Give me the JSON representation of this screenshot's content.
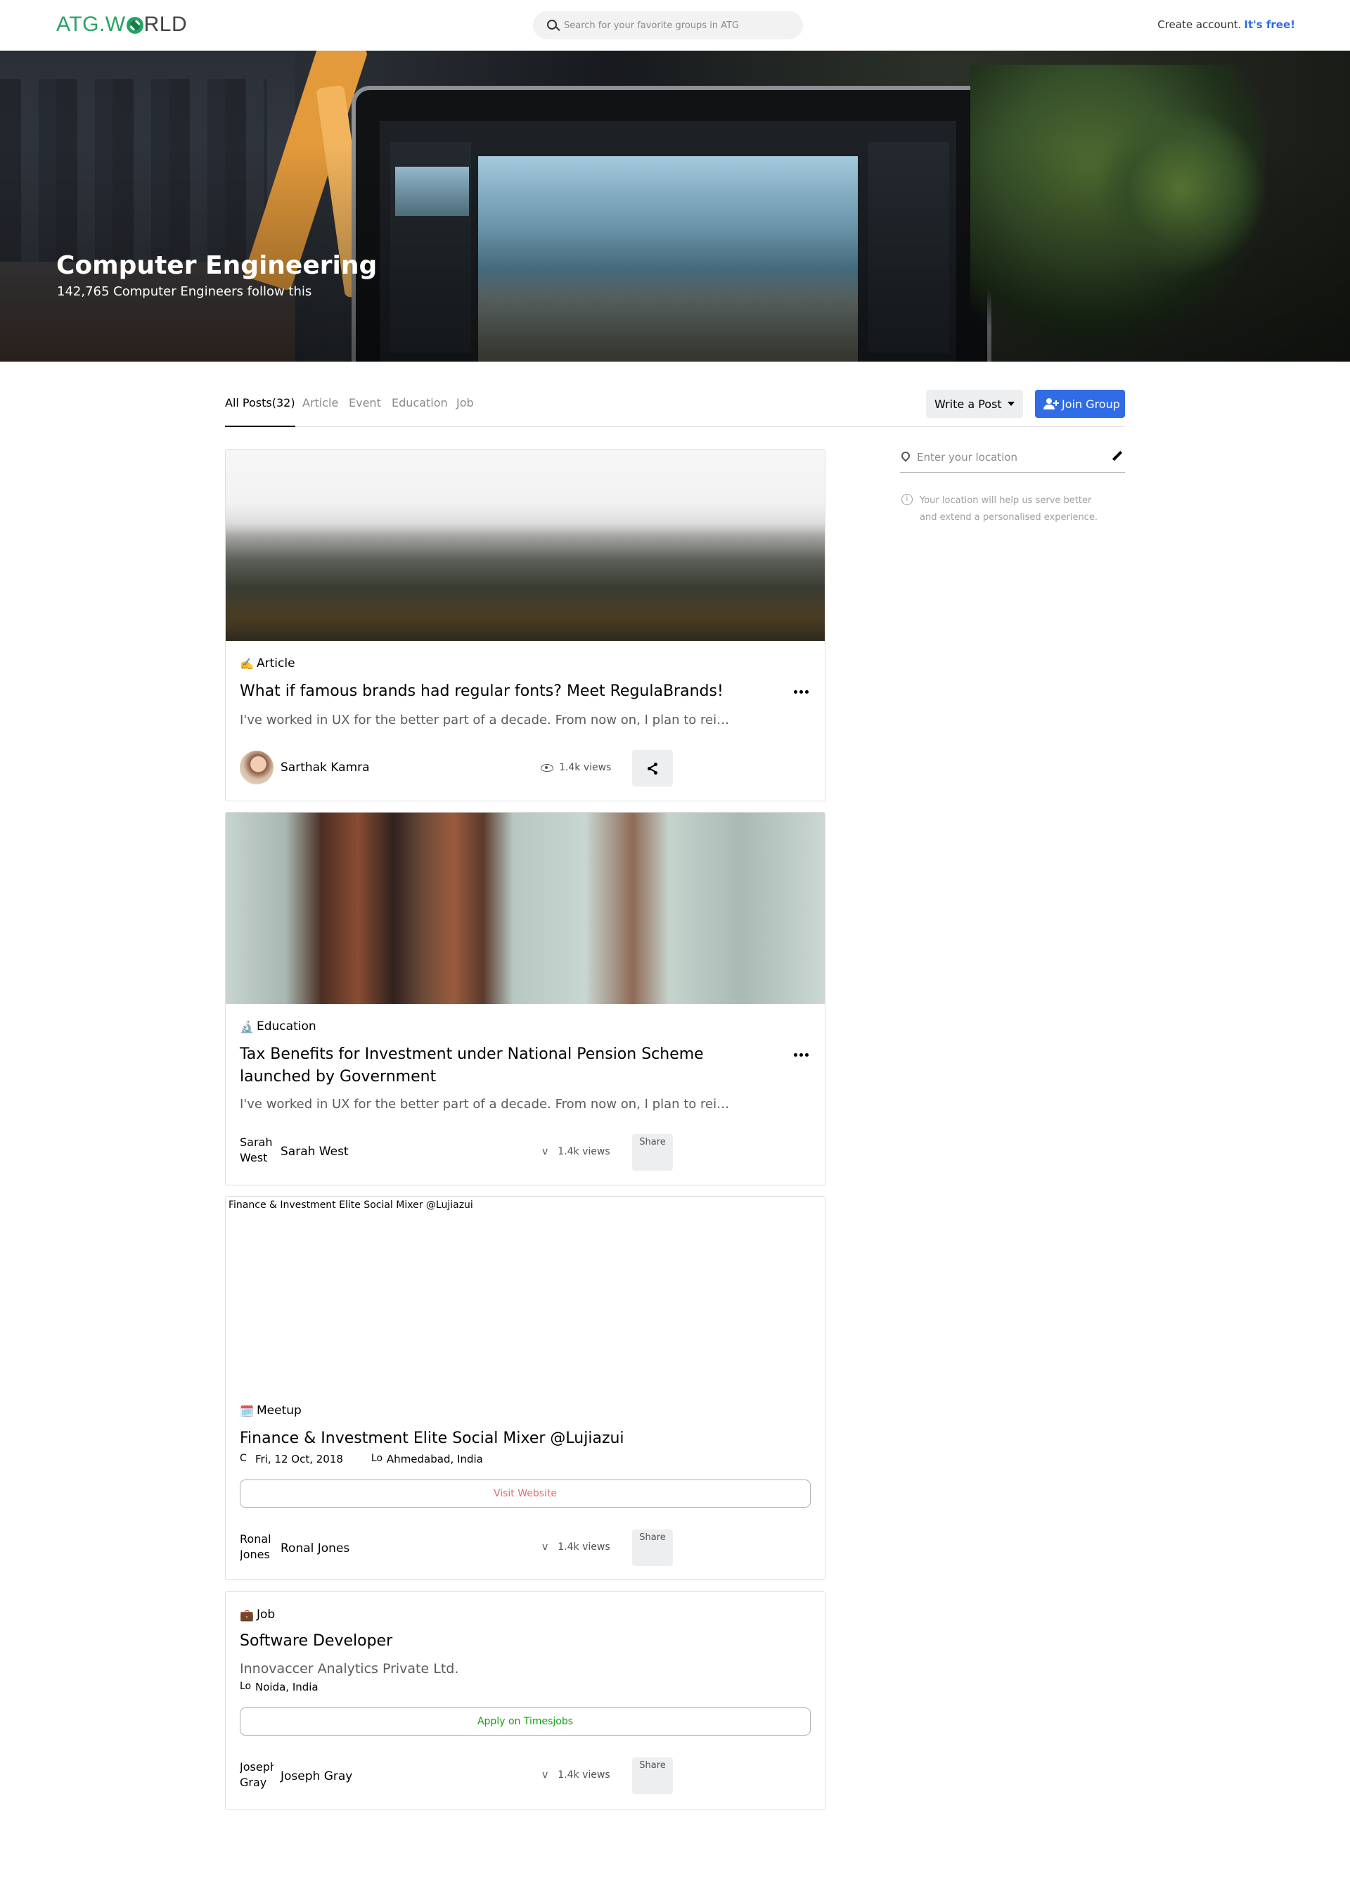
{
  "nav": {
    "logo_prefix": "ATG.W",
    "logo_suffix": "RLD",
    "search_placeholder": "Search for your favorite groups in ATG",
    "create_account": "Create account.",
    "free": "It's free!"
  },
  "hero": {
    "title": "Computer Engineering",
    "subtitle": "142,765 Computer Engineers follow this"
  },
  "tabs": [
    "All Posts(32)",
    "Article",
    "Event",
    "Education",
    "Job"
  ],
  "actions": {
    "write_post": "Write a Post",
    "join_group": "Join Group"
  },
  "location": {
    "placeholder": "Enter your location",
    "info": "Your location will help us serve better and extend a personalised experience."
  },
  "posts": [
    {
      "type_icon": "✍️",
      "type": "Article",
      "title": "What if famous brands had regular fonts? Meet RegulaBrands!",
      "description": "I've worked in UX for the better part of a decade. From now on, I plan to rei…",
      "author": "Sarthak Kamra",
      "views": "1.4k views"
    },
    {
      "type_icon": "🔬",
      "type": "Education",
      "title": "Tax Benefits for Investment under National Pension Scheme launched by Government",
      "description": "I've worked in UX for the better part of a decade. From now on, I plan to rei…",
      "author_alt": "Sarah West",
      "author": "Sarah West",
      "views_alt": "v",
      "views": "1.4k views",
      "share_alt": "Share"
    },
    {
      "image_alt": "Finance & Investment Elite Social Mixer @Lujiazui",
      "type_icon": "🗓️",
      "type": "Meetup",
      "title": "Finance & Investment Elite Social Mixer @Lujiazui",
      "date_alt": "C",
      "date": "Fri, 12 Oct, 2018",
      "location_alt": "Lo",
      "location": "Ahmedabad, India",
      "button": "Visit Website",
      "author_alt": "Ronal Jones",
      "author": "Ronal Jones",
      "views_alt": "v",
      "views": "1.4k views",
      "share_alt": "Share"
    },
    {
      "type_icon": "💼",
      "type": "Job",
      "title": "Software Developer",
      "company": "Innovaccer Analytics Private Ltd.",
      "location_alt": "Lo",
      "location": "Noida, India",
      "button": "Apply on Timesjobs",
      "author_alt": "Joseph Gray",
      "author": "Joseph Gray",
      "views_alt": "v",
      "views": "1.4k views",
      "share_alt": "Share"
    }
  ],
  "colors": {
    "brand_green": "#27A365",
    "primary_blue": "#2F6CE5",
    "visit_red": "#E56C6C",
    "apply_green": "#08A508"
  }
}
